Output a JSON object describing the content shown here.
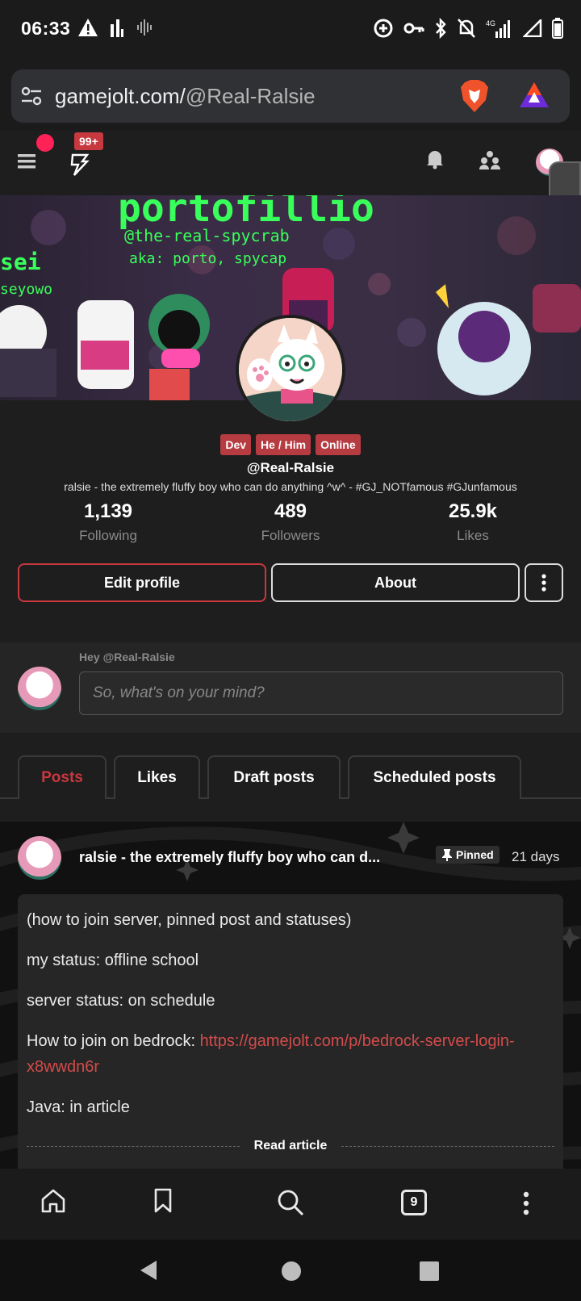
{
  "status_bar": {
    "time": "06:33",
    "network": "4G"
  },
  "browser": {
    "url_domain": "gamejolt.com/",
    "url_path": "@Real-Ralsie",
    "tab_count": "9"
  },
  "app_nav": {
    "notification_badge": "99+"
  },
  "banner": {
    "title": "portofillio",
    "handle": "@the-real-spycrab",
    "aka": "aka: porto, spycap",
    "left_text_1": "sei",
    "left_text_2": "seyowo"
  },
  "profile": {
    "tags": [
      "Dev",
      "He / Him",
      "Online"
    ],
    "username": "@Real-Ralsie",
    "bio": "ralsie - the extremely fluffy boy who can do anything ^w^ - #GJ_NOTfamous #GJunfamous",
    "stats": [
      {
        "num": "1,139",
        "label": "Following"
      },
      {
        "num": "489",
        "label": "Followers"
      },
      {
        "num": "25.9k",
        "label": "Likes"
      }
    ],
    "edit_label": "Edit profile",
    "about_label": "About"
  },
  "composer": {
    "greeting": "Hey @Real-Ralsie",
    "placeholder": "So, what's on your mind?"
  },
  "tabs": [
    "Posts",
    "Likes",
    "Draft posts",
    "Scheduled posts"
  ],
  "post": {
    "author": "ralsie - the extremely fluffy boy who can d...",
    "pinned_label": "Pinned",
    "time": "21 days",
    "line1": "(how to join server, pinned post and statuses)",
    "line2": "my status: offline school",
    "line3": "server status: on schedule",
    "line4_prefix": "How to join on bedrock: ",
    "line4_link": "https://gamejolt.com/p/bedrock-server-login-x8wwdn6r",
    "line5": "Java: in article",
    "read_article": "Read article"
  },
  "colors": {
    "accent": "#c8383f",
    "brand_green": "#39ff5a",
    "notif_dot": "#ff2257"
  }
}
